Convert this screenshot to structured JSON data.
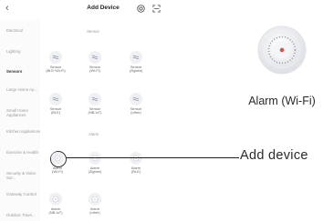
{
  "header": {
    "back_icon": "chevron-left-icon",
    "title": "Add Device",
    "add_icon": "target-icon",
    "scan_icon": "scan-icon"
  },
  "sidebar": {
    "items": [
      {
        "label": "Electrical",
        "active": false
      },
      {
        "label": "Lighting",
        "active": false
      },
      {
        "label": "Sensors",
        "active": true
      },
      {
        "label": "Large Home Ap...",
        "active": false
      },
      {
        "label": "Small Home Appliances",
        "active": false
      },
      {
        "label": "Kitchen Appliances",
        "active": false
      },
      {
        "label": "Exercise & Health",
        "active": false
      },
      {
        "label": "Security & Video Sur...",
        "active": false
      },
      {
        "label": "Gateway Control",
        "active": false
      },
      {
        "label": "Outdoor Trave...",
        "active": false
      }
    ]
  },
  "sections": {
    "sensor": {
      "title": "Sensor",
      "devices": [
        {
          "name": "Sensor",
          "sub": "(BLE+Wi-Fi)",
          "icon": "sensor-icon"
        },
        {
          "name": "Sensor",
          "sub": "(Wi-Fi)",
          "icon": "sensor-icon"
        },
        {
          "name": "Sensor",
          "sub": "(Zigbee)",
          "icon": "sensor-icon"
        },
        {
          "name": "Sensor",
          "sub": "(BLE)",
          "icon": "sensor-icon"
        },
        {
          "name": "Sensor",
          "sub": "(NB-IoT)",
          "icon": "sensor-icon"
        },
        {
          "name": "Sensor",
          "sub": "(other)",
          "icon": "sensor-icon"
        }
      ]
    },
    "alarm": {
      "title": "Alarm",
      "devices": [
        {
          "name": "Alarm",
          "sub": "(Wi-Fi)",
          "icon": "alarm-icon"
        },
        {
          "name": "Alarm",
          "sub": "(Zigbee)",
          "icon": "alarm-icon"
        },
        {
          "name": "Alarm",
          "sub": "(BLE)",
          "icon": "alarm-icon"
        },
        {
          "name": "Alarm",
          "sub": "(NB-IoT)",
          "icon": "alarm-icon"
        },
        {
          "name": "Alarm",
          "sub": "(other)",
          "icon": "alarm-icon"
        }
      ]
    }
  },
  "callout": {
    "label": "Add device"
  },
  "product": {
    "name": "Alarm (Wi-Fi)",
    "icon": "smoke-alarm-icon"
  }
}
